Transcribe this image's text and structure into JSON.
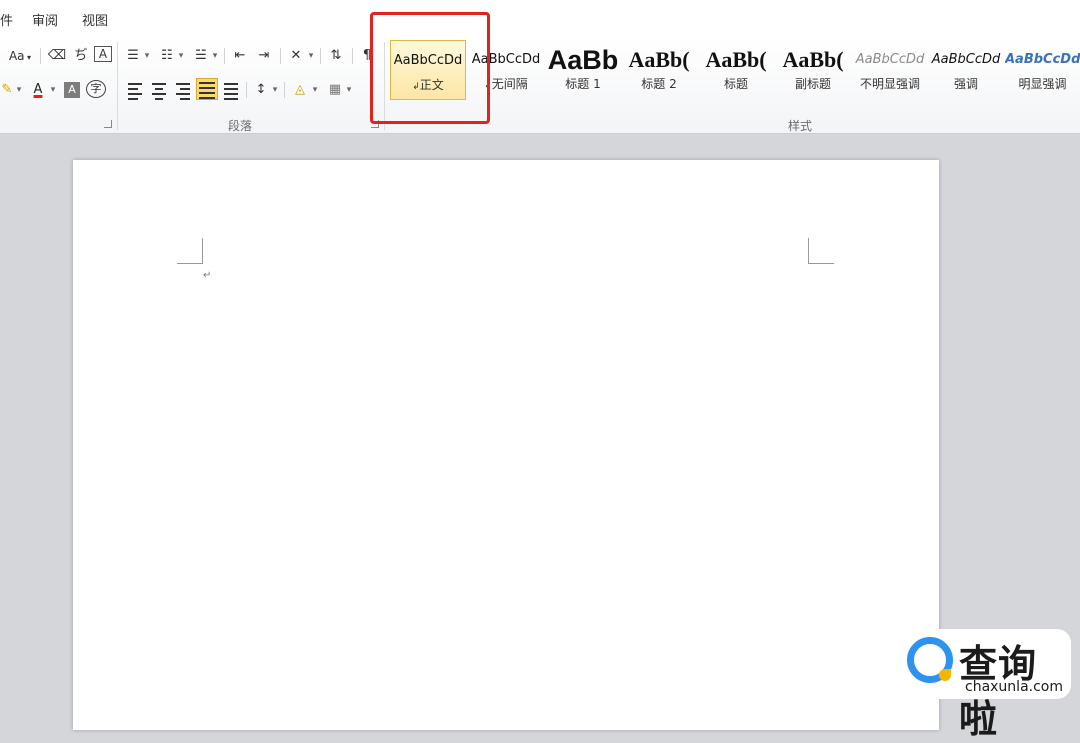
{
  "menubar": {
    "tabs": [
      "件",
      "审阅",
      "视图"
    ]
  },
  "ribbon": {
    "font_group": {
      "change_case_label": "Aa",
      "phonetic_label": "ぢ",
      "char_border_label": "A",
      "font_color_label": "A",
      "char_shading_label": "A",
      "enclose_char_label": "字"
    },
    "paragraph_group": {
      "label": "段落"
    },
    "styles_group": {
      "label": "样式",
      "styles": [
        {
          "sample": "AaBbCcDd",
          "name": "正文",
          "para_mark": "↲",
          "selected": true
        },
        {
          "sample": "AaBbCcDd",
          "name": "无间隔",
          "para_mark": "↲",
          "selected": false
        },
        {
          "sample": "AaBb",
          "name": "标题 1",
          "para_mark": "",
          "selected": false
        },
        {
          "sample": "AaBb(",
          "name": "标题 2",
          "para_mark": "",
          "selected": false
        },
        {
          "sample": "AaBb(",
          "name": "标题",
          "para_mark": "",
          "selected": false
        },
        {
          "sample": "AaBb(",
          "name": "副标题",
          "para_mark": "",
          "selected": false
        },
        {
          "sample": "AaBbCcDd",
          "name": "不明显强调",
          "para_mark": "",
          "selected": false
        },
        {
          "sample": "AaBbCcDd",
          "name": "强调",
          "para_mark": "",
          "selected": false
        },
        {
          "sample": "AaBbCcDd",
          "name": "明显强调",
          "para_mark": "",
          "selected": false
        }
      ]
    }
  },
  "document": {
    "paragraph_mark": "↵"
  },
  "watermark": {
    "cn": "查询啦",
    "en": "chaxunla.com"
  },
  "colors": {
    "highlight_box": "#e0231f",
    "selected_style": "#fde7a6",
    "intense_emphasis": "#3b73b9",
    "subtle_emphasis": "#8a8a8a",
    "logo_blue": "#2d93ef",
    "logo_yellow": "#f5b600"
  }
}
